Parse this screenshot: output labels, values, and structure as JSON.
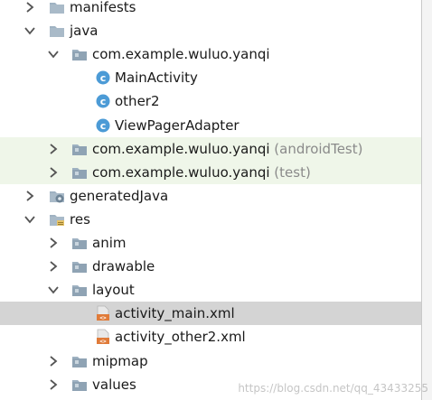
{
  "tree": {
    "items": [
      {
        "label": "manifests",
        "suffix": "",
        "depth": 1,
        "arrow": "right",
        "icon": "folder"
      },
      {
        "label": "java",
        "suffix": "",
        "depth": 1,
        "arrow": "down",
        "icon": "folder"
      },
      {
        "label": "com.example.wuluo.yanqi",
        "suffix": "",
        "depth": 2,
        "arrow": "down",
        "icon": "package"
      },
      {
        "label": "MainActivity",
        "suffix": "",
        "depth": 3,
        "arrow": "none",
        "icon": "class"
      },
      {
        "label": "other2",
        "suffix": "",
        "depth": 3,
        "arrow": "none",
        "icon": "class"
      },
      {
        "label": "ViewPagerAdapter",
        "suffix": "",
        "depth": 3,
        "arrow": "none",
        "icon": "class"
      },
      {
        "label": "com.example.wuluo.yanqi",
        "suffix": " (androidTest)",
        "depth": 2,
        "arrow": "right",
        "icon": "package",
        "highlight": "green"
      },
      {
        "label": "com.example.wuluo.yanqi",
        "suffix": " (test)",
        "depth": 2,
        "arrow": "right",
        "icon": "package",
        "highlight": "green"
      },
      {
        "label": "generatedJava",
        "suffix": "",
        "depth": 1,
        "arrow": "right",
        "icon": "generated-folder"
      },
      {
        "label": "res",
        "suffix": "",
        "depth": 1,
        "arrow": "down",
        "icon": "res-folder"
      },
      {
        "label": "anim",
        "suffix": "",
        "depth": 2,
        "arrow": "right",
        "icon": "package"
      },
      {
        "label": "drawable",
        "suffix": "",
        "depth": 2,
        "arrow": "right",
        "icon": "package"
      },
      {
        "label": "layout",
        "suffix": "",
        "depth": 2,
        "arrow": "down",
        "icon": "package"
      },
      {
        "label": "activity_main.xml",
        "suffix": "",
        "depth": 3,
        "arrow": "none",
        "icon": "xml",
        "selected": true
      },
      {
        "label": "activity_other2.xml",
        "suffix": "",
        "depth": 3,
        "arrow": "none",
        "icon": "xml"
      },
      {
        "label": "mipmap",
        "suffix": "",
        "depth": 2,
        "arrow": "right",
        "icon": "package"
      },
      {
        "label": "values",
        "suffix": "",
        "depth": 2,
        "arrow": "right",
        "icon": "package"
      }
    ]
  },
  "watermark": "https://blog.csdn.net/qq_43433255",
  "colors": {
    "folder": "#9fb2c2",
    "class_circle": "#4c9bd6",
    "xml_badge": "#e07b39",
    "green_highlight": "#eff6e9",
    "selected": "#d4d4d4"
  }
}
